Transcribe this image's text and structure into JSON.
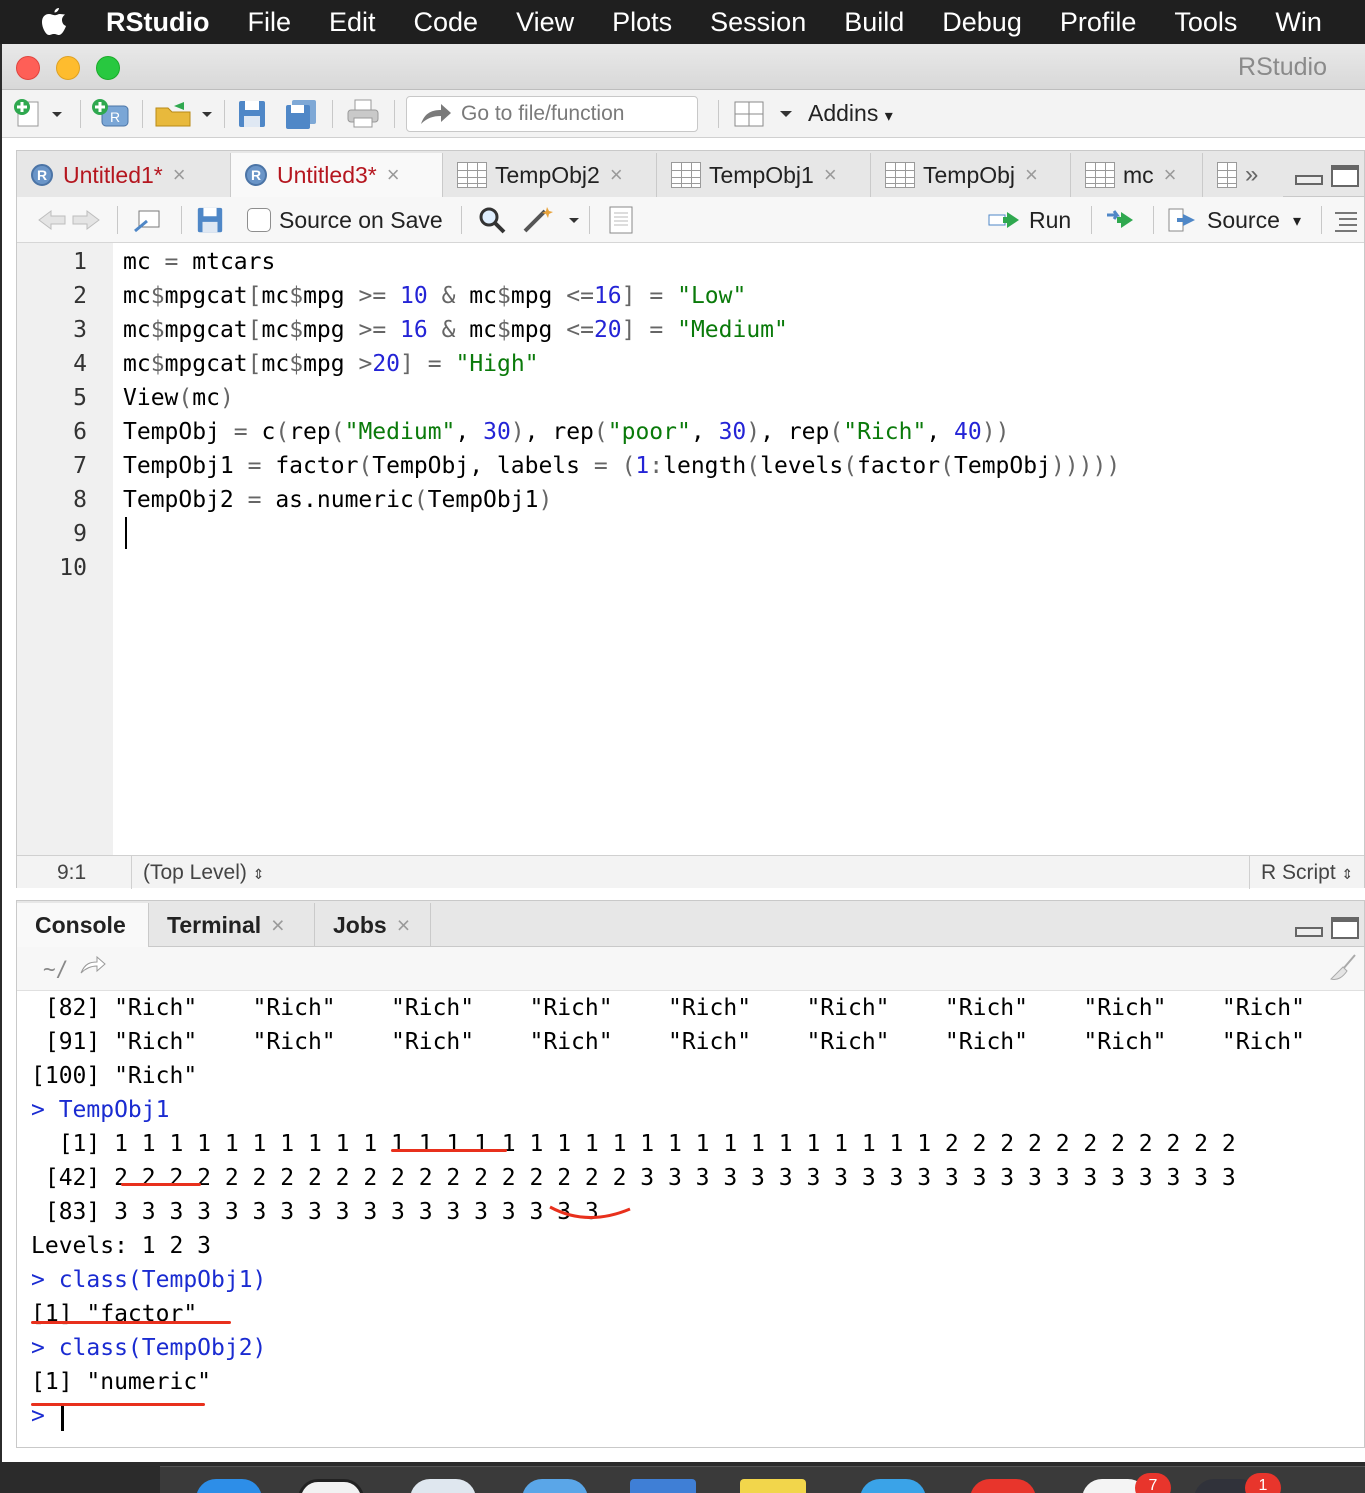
{
  "menubar": {
    "app": "RStudio",
    "items": [
      "File",
      "Edit",
      "Code",
      "View",
      "Plots",
      "Session",
      "Build",
      "Debug",
      "Profile",
      "Tools",
      "Win"
    ]
  },
  "window": {
    "title": "RStudio"
  },
  "toolbar": {
    "goto_placeholder": "Go to file/function",
    "addins_label": "Addins"
  },
  "source": {
    "tabs": [
      {
        "label": "Untitled1*",
        "kind": "r",
        "dirty": true
      },
      {
        "label": "Untitled3*",
        "kind": "r",
        "dirty": true,
        "active": true
      },
      {
        "label": "TempObj2",
        "kind": "data"
      },
      {
        "label": "TempObj1",
        "kind": "data"
      },
      {
        "label": "TempObj",
        "kind": "data"
      },
      {
        "label": "mc",
        "kind": "data"
      }
    ],
    "source_on_save": "Source on Save",
    "run_label": "Run",
    "source_label": "Source",
    "line_numbers": [
      "1",
      "2",
      "3",
      "4",
      "5",
      "6",
      "7",
      "8",
      "9",
      "10"
    ],
    "lines": [
      "mc = mtcars",
      "mc$mpgcat[mc$mpg >= 10 & mc$mpg <=16] = \"Low\"",
      "mc$mpgcat[mc$mpg >= 16 & mc$mpg <=20] = \"Medium\"",
      "mc$mpgcat[mc$mpg >20] = \"High\"",
      "View(mc)",
      "TempObj = c(rep(\"Medium\", 30), rep(\"poor\", 30), rep(\"Rich\", 40))",
      "TempObj1 = factor(TempObj, labels = (1:length(levels(factor(TempObj)))))",
      "TempObj2 = as.numeric(TempObj1)",
      "",
      ""
    ],
    "status": {
      "position": "9:1",
      "scope": "(Top Level)",
      "file_type": "R Script"
    }
  },
  "console": {
    "tabs": [
      {
        "label": "Console",
        "active": true
      },
      {
        "label": "Terminal"
      },
      {
        "label": "Jobs"
      }
    ],
    "path": "~/",
    "lines": [
      {
        "text": " [82] \"Rich\"    \"Rich\"    \"Rich\"    \"Rich\"    \"Rich\"    \"Rich\"    \"Rich\"    \"Rich\"    \"Rich\"",
        "kind": "out"
      },
      {
        "text": " [91] \"Rich\"    \"Rich\"    \"Rich\"    \"Rich\"    \"Rich\"    \"Rich\"    \"Rich\"    \"Rich\"    \"Rich\"",
        "kind": "out"
      },
      {
        "text": "[100] \"Rich\"",
        "kind": "out"
      },
      {
        "text": "> TempObj1",
        "kind": "cmd"
      },
      {
        "text": "  [1] 1 1 1 1 1 1 1 1 1 1 1 1 1 1 1 1 1 1 1 1 1 1 1 1 1 1 1 1 1 1 2 2 2 2 2 2 2 2 2 2 2",
        "kind": "out"
      },
      {
        "text": " [42] 2 2 2 2 2 2 2 2 2 2 2 2 2 2 2 2 2 2 2 3 3 3 3 3 3 3 3 3 3 3 3 3 3 3 3 3 3 3 3 3 3",
        "kind": "out"
      },
      {
        "text": " [83] 3 3 3 3 3 3 3 3 3 3 3 3 3 3 3 3 3 3",
        "kind": "out"
      },
      {
        "text": "Levels: 1 2 3",
        "kind": "out"
      },
      {
        "text": "> class(TempObj1)",
        "kind": "cmd"
      },
      {
        "text": "[1] \"factor\"",
        "kind": "out"
      },
      {
        "text": "> class(TempObj2)",
        "kind": "cmd"
      },
      {
        "text": "[1] \"numeric\"",
        "kind": "out"
      },
      {
        "text": ">",
        "kind": "cmd"
      }
    ]
  },
  "dock": {
    "badges": [
      "7",
      "1"
    ]
  },
  "colors": {
    "console_command": "#1a2bd1",
    "string": "#0a7a0a",
    "number": "#2424d6",
    "dirty_tab": "#b5161f",
    "annotation": "#e8301c"
  }
}
